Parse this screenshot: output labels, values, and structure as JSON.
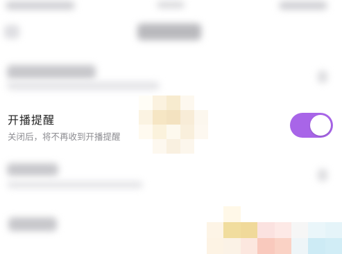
{
  "settings": {
    "live_reminder": {
      "title": "开播提醒",
      "description": "关闭后，将不再收到开播提醒",
      "enabled": true
    }
  },
  "colors": {
    "toggle_on": "#a865e8",
    "title_text": "#222222",
    "subtitle_text": "#8d8d92",
    "background": "#ffffff"
  },
  "icons": {
    "toggle": "toggle-switch-icon"
  }
}
